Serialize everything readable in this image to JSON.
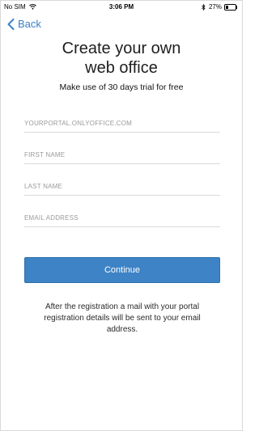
{
  "status_bar": {
    "carrier": "No SIM",
    "time": "3:06 PM",
    "battery": "27%",
    "battery_level": 0.27
  },
  "nav": {
    "back_label": "Back",
    "accent_color": "#3b82c4"
  },
  "header": {
    "title": "Create your own\nweb office",
    "subtitle": "Make use of 30 days trial for free"
  },
  "form": {
    "portal_placeholder": "YOURPORTAL.ONLYOFFICE.COM",
    "portal_value": "",
    "first_name_placeholder": "FIRST NAME",
    "first_name_value": "",
    "last_name_placeholder": "LAST NAME",
    "last_name_value": "",
    "email_placeholder": "EMAIL ADDRESS",
    "email_value": ""
  },
  "actions": {
    "continue_label": "Continue",
    "button_color": "#3d83c6"
  },
  "footer": {
    "note": "After the registration a mail with your portal registration details will be sent to your email address."
  }
}
